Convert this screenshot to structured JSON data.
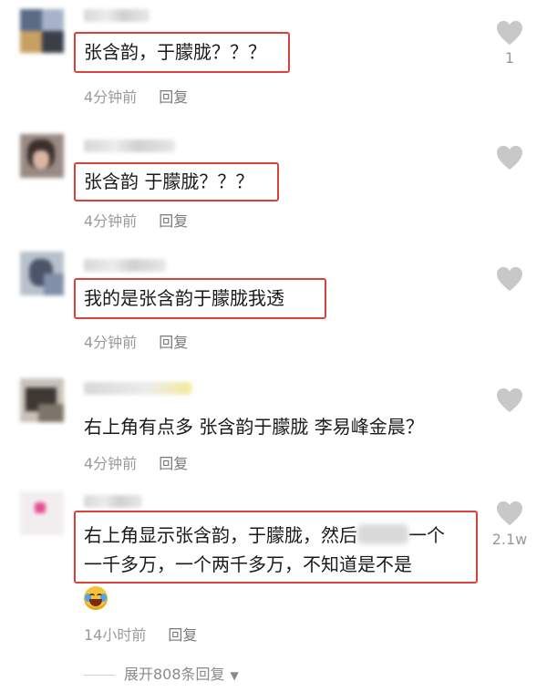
{
  "comments": [
    {
      "text": "张含韵，于朦胧？？？",
      "time": "4分钟前",
      "reply_label": "回复",
      "likes": "1",
      "highlighted": true
    },
    {
      "text": "张含韵 于朦胧？？？",
      "time": "4分钟前",
      "reply_label": "回复",
      "likes": "",
      "highlighted": true
    },
    {
      "text": "我的是张含韵于朦胧我透",
      "time": "4分钟前",
      "reply_label": "回复",
      "likes": "",
      "highlighted": true
    },
    {
      "text": "右上角有点多 张含韵于朦胧 李易峰金晨？",
      "time": "4分钟前",
      "reply_label": "回复",
      "likes": "",
      "highlighted": false
    },
    {
      "text_line1_a": "右上角显示张含韵，于朦胧，然后",
      "text_line1_b": "一个",
      "text_line2": "一千多万，一个两千多万，不知道是不是",
      "time": "14小时前",
      "reply_label": "回复",
      "likes": "2.1w",
      "highlighted": true
    }
  ],
  "expand_replies": "展开808条回复",
  "colors": {
    "highlight_border": "#d8413c",
    "heart": "#c8c8c8",
    "meta_text": "#9a9a9a"
  },
  "icons": {
    "like": "heart-icon",
    "expand": "caret-down-icon",
    "emoji": "laughing-crying-emoji-icon"
  }
}
